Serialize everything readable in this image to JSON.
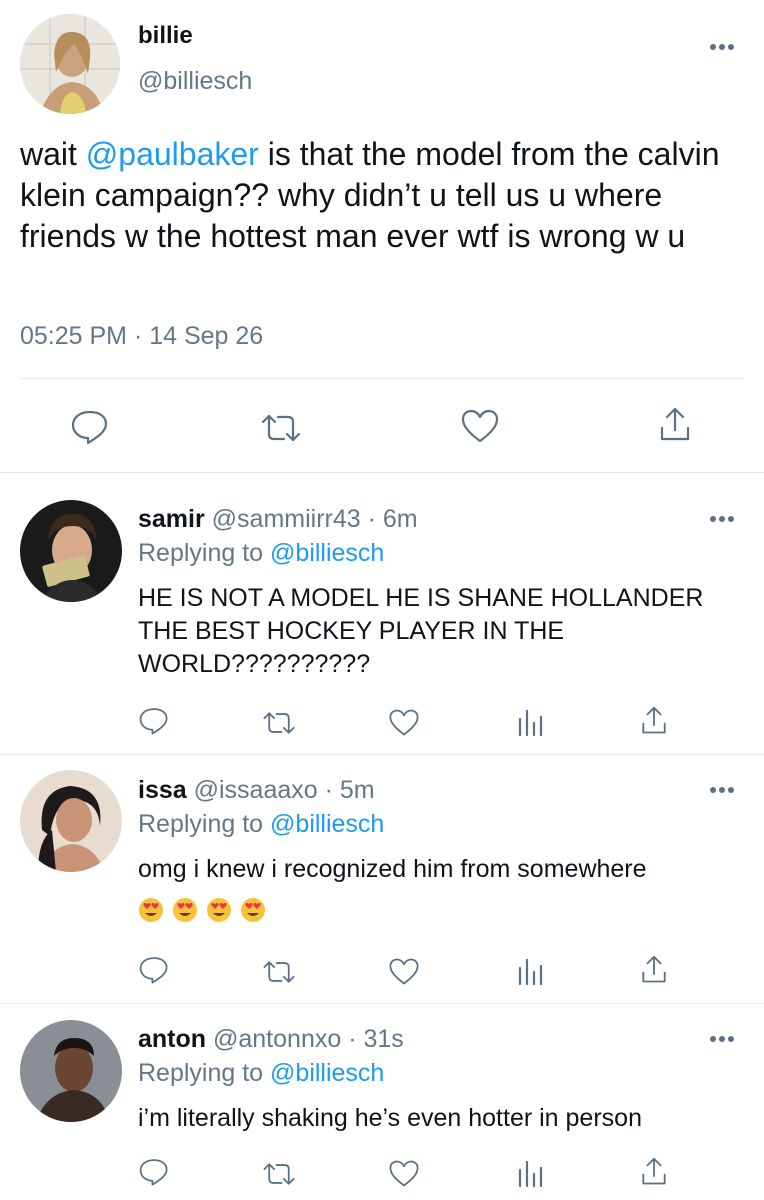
{
  "main_tweet": {
    "author_name": "billie",
    "author_handle": "@billiesch",
    "text_prefix": "wait ",
    "mention": "@paulbaker",
    "text_rest": " is that the model from the calvin klein campaign?? why didn’t u tell us u where friends w the hottest man ever wtf is wrong w u",
    "timestamp": "05:25 PM · 14 Sep 26"
  },
  "replies": [
    {
      "name": "samir",
      "meta": "@sammiirr43 · 6m",
      "replying_label": "Replying to ",
      "replying_handle": "@billiesch",
      "text": "HE IS NOT A MODEL HE IS SHANE HOLLANDER THE BEST HOCKEY PLAYER IN THE WORLD??????????"
    },
    {
      "name": "issa",
      "meta": "@issaaaxo · 5m",
      "replying_label": "Replying to ",
      "replying_handle": "@billiesch",
      "text": "omg i knew i recognized him from somewhere",
      "emojis": [
        "heart-eyes-emoji",
        "heart-eyes-emoji",
        "heart-eyes-emoji",
        "heart-eyes-emoji"
      ]
    },
    {
      "name": "anton",
      "meta": "@antonnxo · 31s",
      "replying_label": "Replying to ",
      "replying_handle": "@billiesch",
      "text": "i’m literally shaking he’s even hotter in person"
    }
  ],
  "colors": {
    "link": "#1d9bf0",
    "secondary_text": "#657786",
    "icon": "#5b7083",
    "divider": "#e6ecf0"
  }
}
